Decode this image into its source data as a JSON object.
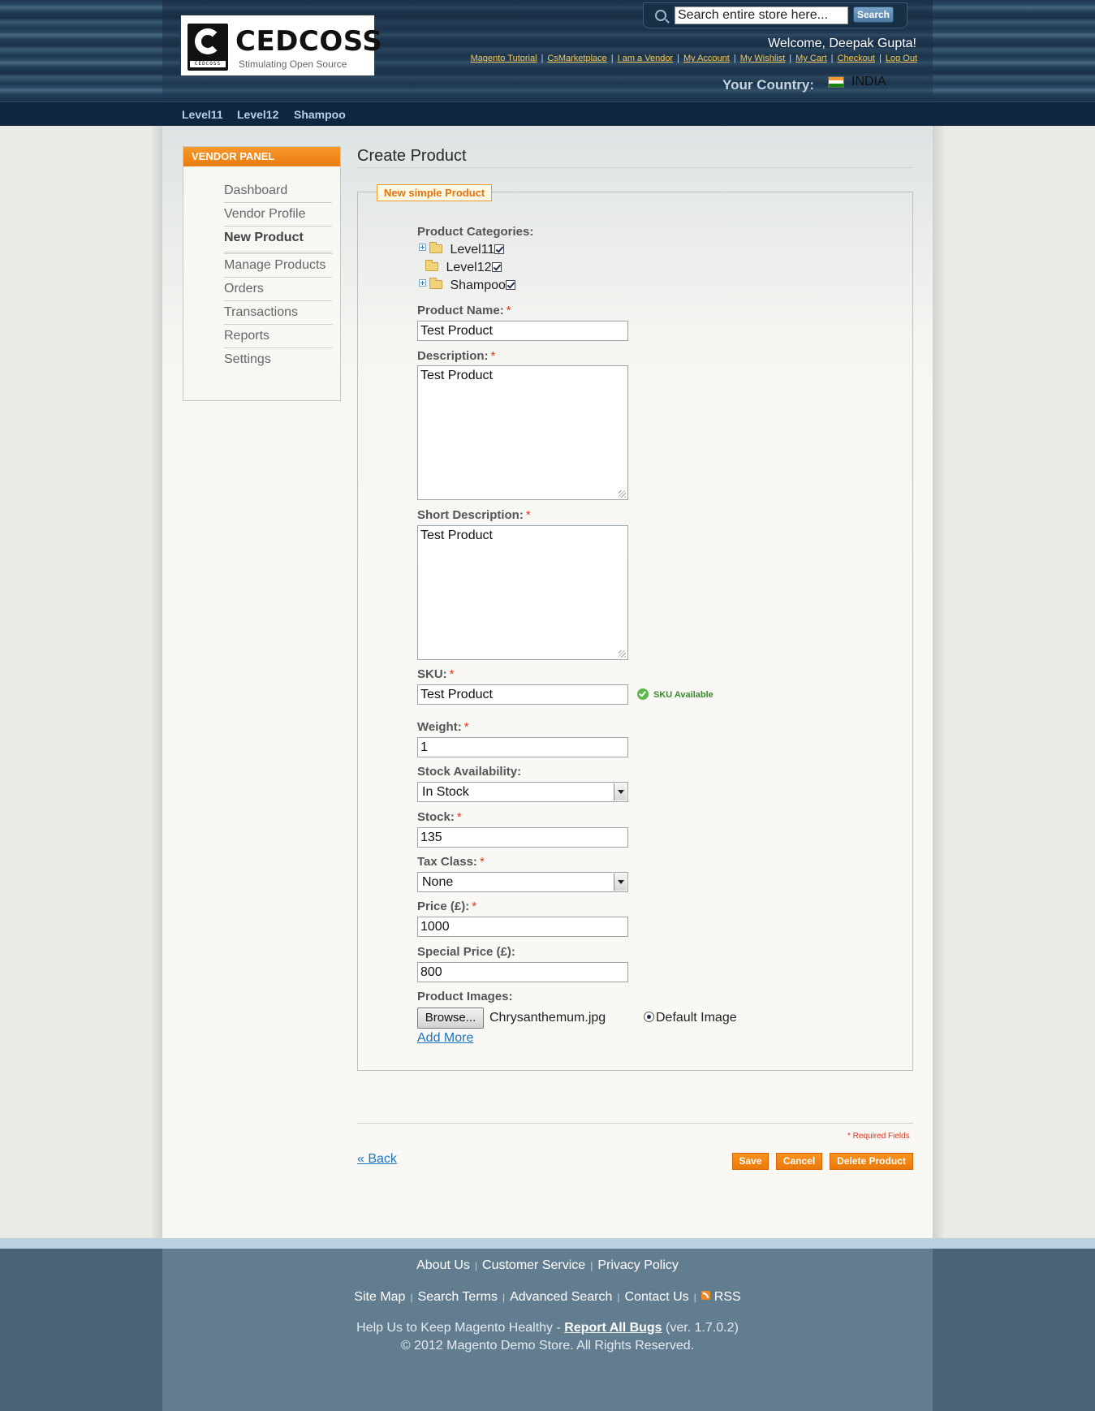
{
  "header": {
    "logo": {
      "name": "CEDCOSS",
      "tagline": "Stimulating Open Source",
      "mark_text": "CEDCOSS"
    },
    "search": {
      "value": "Search entire store here...",
      "button": "Search"
    },
    "welcome": "Welcome, Deepak Gupta!",
    "links": [
      "Magento Tutorial",
      "CsMarketplace",
      "I am a Vendor",
      "My Account",
      "My Wishlist",
      "My Cart",
      "Checkout",
      "Log Out"
    ],
    "country_label": "Your Country:",
    "country": "INDIA"
  },
  "nav": [
    "Level11",
    "Level12",
    "Shampoo"
  ],
  "vendor_panel": {
    "title": "VENDOR PANEL",
    "items": [
      "Dashboard",
      "Vendor Profile",
      "New Product",
      "Manage Products",
      "Orders",
      "Transactions",
      "Reports",
      "Settings"
    ],
    "active": "New Product"
  },
  "page_title": "Create Product",
  "legend": "New simple Product",
  "form": {
    "categories_label": "Product Categories:",
    "categories": [
      "Level11",
      "Level12",
      "Shampoo"
    ],
    "product_name": {
      "label": "Product Name:",
      "value": "Test Product"
    },
    "description": {
      "label": "Description:",
      "value": "Test Product"
    },
    "short_description": {
      "label": "Short Description:",
      "value": "Test Product"
    },
    "sku": {
      "label": "SKU:",
      "value": "Test Product",
      "status": "SKU Available"
    },
    "weight": {
      "label": "Weight:",
      "value": "1"
    },
    "stock_availability": {
      "label": "Stock Availability:",
      "value": "In Stock"
    },
    "stock": {
      "label": "Stock:",
      "value": "135"
    },
    "tax_class": {
      "label": "Tax Class:",
      "value": "None"
    },
    "price": {
      "label": "Price (£):",
      "value": "1000"
    },
    "special_price": {
      "label": "Special Price (£):",
      "value": "800"
    },
    "images": {
      "label": "Product Images:",
      "browse": "Browse...",
      "file": "Chrysanthemum.jpg",
      "default_label": "Default Image",
      "add_more": "Add More"
    },
    "required_asterisk": "*"
  },
  "actions": {
    "required_note": "* Required Fields",
    "back": "« Back",
    "save": "Save",
    "cancel": "Cancel",
    "delete": "Delete Product"
  },
  "footer": {
    "row1": [
      "About Us",
      "Customer Service",
      "Privacy Policy"
    ],
    "row2": [
      "Site Map",
      "Search Terms",
      "Advanced Search",
      "Contact Us",
      "RSS"
    ],
    "help_prefix": "Help Us to Keep Magento Healthy - ",
    "help_link": "Report All Bugs",
    "help_suffix": " (ver. 1.7.0.2)",
    "copyright": "© 2012 Magento Demo Store. All Rights Reserved."
  }
}
